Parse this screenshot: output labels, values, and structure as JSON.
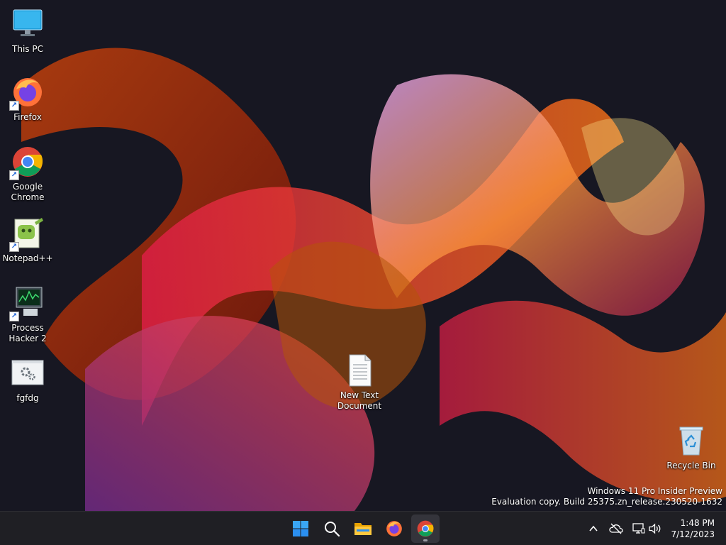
{
  "desktop": {
    "icons": [
      {
        "label": "This PC",
        "icon": "this-pc-icon"
      },
      {
        "label": "Firefox",
        "icon": "firefox-icon"
      },
      {
        "label": "Google Chrome",
        "icon": "chrome-icon"
      },
      {
        "label": "Notepad++",
        "icon": "notepadpp-icon"
      },
      {
        "label": "Process Hacker 2",
        "icon": "process-hacker-icon"
      },
      {
        "label": "fgfdg",
        "icon": "settings-file-icon"
      },
      {
        "label": "New Text Document",
        "icon": "text-document-icon"
      },
      {
        "label": "Recycle Bin",
        "icon": "recycle-bin-icon"
      }
    ],
    "watermark": {
      "line1": "Windows 11 Pro Insider Preview",
      "line2": "Evaluation copy. Build 25375.zn_release.230520-1632"
    }
  },
  "taskbar": {
    "apps": [
      {
        "name": "Start",
        "icon": "windows-start-icon"
      },
      {
        "name": "Search",
        "icon": "search-icon"
      },
      {
        "name": "File Explorer",
        "icon": "file-explorer-icon"
      },
      {
        "name": "Firefox",
        "icon": "firefox-icon"
      },
      {
        "name": "Google Chrome",
        "icon": "chrome-icon",
        "active": true
      }
    ],
    "tray": {
      "icons": [
        "chevron-up-icon",
        "cloud-offline-icon",
        "network-icon",
        "volume-icon"
      ],
      "time": "1:48 PM",
      "date": "7/12/2023"
    }
  },
  "colors": {
    "taskbar_bg": "#1f1f24",
    "wallpaper_bg": "#171722",
    "accent": "#0078d4"
  }
}
